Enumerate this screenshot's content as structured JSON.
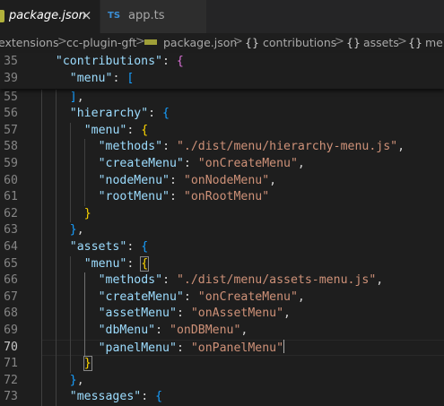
{
  "tabs": [
    {
      "label": "package.json",
      "close": "×"
    },
    {
      "label": "app.ts",
      "icon_text": "TS"
    }
  ],
  "breadcrumb": {
    "items": [
      "extensions",
      "cc-plugin-gft",
      "package.json",
      "contributions",
      "assets",
      "menu"
    ],
    "separator": ">",
    "brace": "{}"
  },
  "editor": {
    "sticky": [
      {
        "ln": "35",
        "indent": 2,
        "parts": [
          [
            "k",
            "\"contributions\""
          ],
          [
            "p",
            ": "
          ],
          [
            "b1",
            "{"
          ]
        ]
      },
      {
        "ln": "39",
        "indent": 4,
        "parts": [
          [
            "k",
            "\"menu\""
          ],
          [
            "p",
            ": "
          ],
          [
            "b2",
            "["
          ]
        ]
      }
    ],
    "lines": [
      {
        "ln": "55",
        "indent": 4,
        "parts": [
          [
            "b2",
            "]"
          ],
          [
            "p",
            ","
          ]
        ]
      },
      {
        "ln": "56",
        "indent": 4,
        "parts": [
          [
            "k",
            "\"hierarchy\""
          ],
          [
            "p",
            ": "
          ],
          [
            "b2",
            "{"
          ]
        ]
      },
      {
        "ln": "57",
        "indent": 6,
        "parts": [
          [
            "k",
            "\"menu\""
          ],
          [
            "p",
            ": "
          ],
          [
            "b3",
            "{"
          ]
        ]
      },
      {
        "ln": "58",
        "indent": 8,
        "parts": [
          [
            "k",
            "\"methods\""
          ],
          [
            "p",
            ": "
          ],
          [
            "s",
            "\"./dist/menu/hierarchy-menu.js\""
          ],
          [
            "p",
            ","
          ]
        ]
      },
      {
        "ln": "59",
        "indent": 8,
        "parts": [
          [
            "k",
            "\"createMenu\""
          ],
          [
            "p",
            ": "
          ],
          [
            "s",
            "\"onCreateMenu\""
          ],
          [
            "p",
            ","
          ]
        ]
      },
      {
        "ln": "60",
        "indent": 8,
        "parts": [
          [
            "k",
            "\"nodeMenu\""
          ],
          [
            "p",
            ": "
          ],
          [
            "s",
            "\"onNodeMenu\""
          ],
          [
            "p",
            ","
          ]
        ]
      },
      {
        "ln": "61",
        "indent": 8,
        "parts": [
          [
            "k",
            "\"rootMenu\""
          ],
          [
            "p",
            ": "
          ],
          [
            "s",
            "\"onRootMenu\""
          ]
        ]
      },
      {
        "ln": "62",
        "indent": 6,
        "parts": [
          [
            "b3",
            "}"
          ]
        ]
      },
      {
        "ln": "63",
        "indent": 4,
        "parts": [
          [
            "b2",
            "}"
          ],
          [
            "p",
            ","
          ]
        ]
      },
      {
        "ln": "64",
        "indent": 4,
        "parts": [
          [
            "k",
            "\"assets\""
          ],
          [
            "p",
            ": "
          ],
          [
            "b2",
            "{"
          ]
        ]
      },
      {
        "ln": "65",
        "indent": 6,
        "parts": [
          [
            "k",
            "\"menu\""
          ],
          [
            "p",
            ": "
          ],
          [
            "b3",
            "{"
          ]
        ]
      },
      {
        "ln": "66",
        "indent": 8,
        "parts": [
          [
            "k",
            "\"methods\""
          ],
          [
            "p",
            ": "
          ],
          [
            "s",
            "\"./dist/menu/assets-menu.js\""
          ],
          [
            "p",
            ","
          ]
        ]
      },
      {
        "ln": "67",
        "indent": 8,
        "parts": [
          [
            "k",
            "\"createMenu\""
          ],
          [
            "p",
            ": "
          ],
          [
            "s",
            "\"onCreateMenu\""
          ],
          [
            "p",
            ","
          ]
        ]
      },
      {
        "ln": "68",
        "indent": 8,
        "parts": [
          [
            "k",
            "\"assetMenu\""
          ],
          [
            "p",
            ": "
          ],
          [
            "s",
            "\"onAssetMenu\""
          ],
          [
            "p",
            ","
          ]
        ]
      },
      {
        "ln": "69",
        "indent": 8,
        "parts": [
          [
            "k",
            "\"dbMenu\""
          ],
          [
            "p",
            ": "
          ],
          [
            "s",
            "\"onDBMenu\""
          ],
          [
            "p",
            ","
          ]
        ]
      },
      {
        "ln": "70",
        "indent": 8,
        "parts": [
          [
            "k",
            "\"panelMenu\""
          ],
          [
            "p",
            ": "
          ],
          [
            "s",
            "\"onPanelMenu\""
          ]
        ],
        "current": true
      },
      {
        "ln": "71",
        "indent": 6,
        "parts": [
          [
            "b3",
            "}"
          ]
        ]
      },
      {
        "ln": "72",
        "indent": 4,
        "parts": [
          [
            "b2",
            "}"
          ],
          [
            "p",
            ","
          ]
        ]
      },
      {
        "ln": "73",
        "indent": 4,
        "parts": [
          [
            "k",
            "\"messages\""
          ],
          [
            "p",
            ": "
          ],
          [
            "b2",
            "{"
          ]
        ]
      }
    ]
  },
  "colors": {
    "background": "#1e1e1e",
    "key": "#9cdcfe",
    "string": "#ce9178",
    "bracket_gold": "#ffd700"
  }
}
